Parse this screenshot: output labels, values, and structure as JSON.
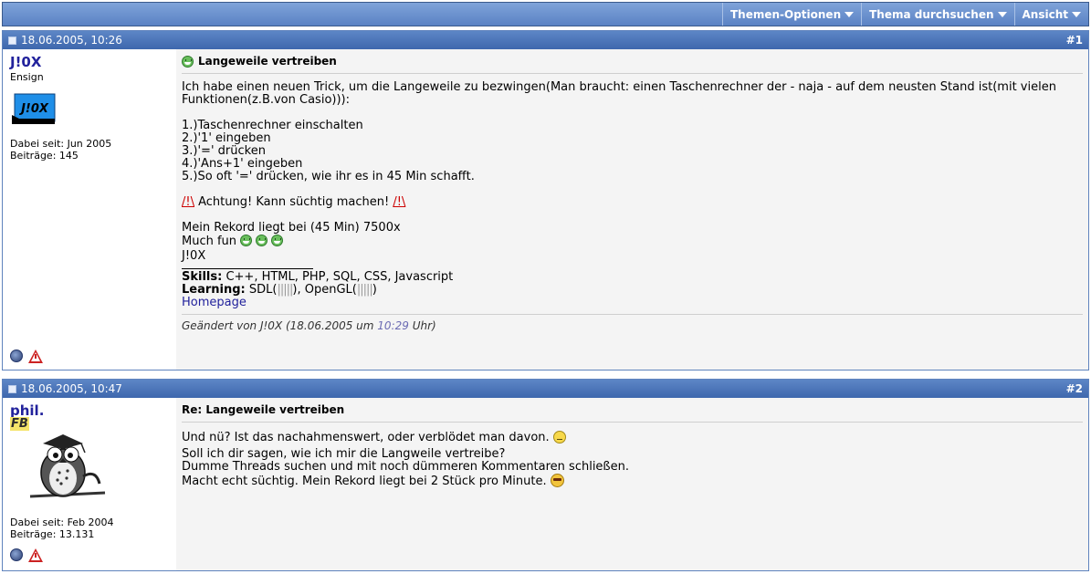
{
  "toolbar": {
    "thread_options": "Themen-Optionen",
    "search_thread": "Thema durchsuchen",
    "view": "Ansicht"
  },
  "posts": [
    {
      "date": "18.06.2005, 10:26",
      "number": "#1",
      "username": "J!0X",
      "usertitle": "Ensign",
      "avatar_text": "J!0X",
      "joined": "Dabei seit: Jun 2005",
      "posts": "Beiträge: 145",
      "title": "Langeweile vertreiben",
      "intro": "Ich habe einen neuen Trick, um die Langeweile zu bezwingen(Man braucht: einen Taschenrechner der - naja - auf dem neusten Stand ist(mit vielen Funktionen(z.B.von Casio))):",
      "steps": [
        "1.)Taschenrechner einschalten",
        "2.)'1' eingeben",
        "3.)'=' drücken",
        "4.)'Ans+1' eingeben",
        "5.)So oft '=' drücken, wie ihr es in 45 Min schafft."
      ],
      "warning_mark": "/!\\",
      "warning": " Achtung! Kann süchtig machen! ",
      "record": "Mein Rekord liegt bei (45 Min) 7500x",
      "much_fun": "Much fun",
      "signoff": "J!0X",
      "sig_skills_label": "Skills:",
      "sig_skills": " C++, HTML, PHP, SQL, CSS, Javascript",
      "sig_learning_label": "Learning:",
      "sig_learning_sdl": " SDL(",
      "sig_bars_sdl": "|||||",
      "sig_learning_gl": "), OpenGL(",
      "sig_bars_gl": "|||||",
      "sig_close": ")",
      "homepage": "Homepage",
      "edited_prefix": "Geändert von J!0X (18.06.2005 um ",
      "edited_time": "10:29",
      "edited_suffix": " Uhr)"
    },
    {
      "date": "18.06.2005, 10:47",
      "number": "#2",
      "username": "phil.",
      "usertitle_badge": "FB",
      "joined": "Dabei seit: Feb 2004",
      "posts": "Beiträge: 13.131",
      "title": "Re: Langeweile vertreiben",
      "line1": "Und nü? Ist das nachahmenswert, oder verblödet man davon.",
      "line2": "Soll ich dir sagen, wie ich mir die Langweile vertreibe?",
      "line3": "Dumme Threads suchen und mit noch dümmeren Kommentaren schließen.",
      "line4": "Macht echt süchtig. Mein Rekord liegt bei 2 Stück pro Minute."
    }
  ],
  "icons": {
    "online": "online-status-icon",
    "report": "report-post-icon",
    "smilie_grin": "grin-smilie-icon",
    "smilie_confused": "confused-smilie-icon",
    "smilie_cool": "cool-smilie-icon"
  }
}
